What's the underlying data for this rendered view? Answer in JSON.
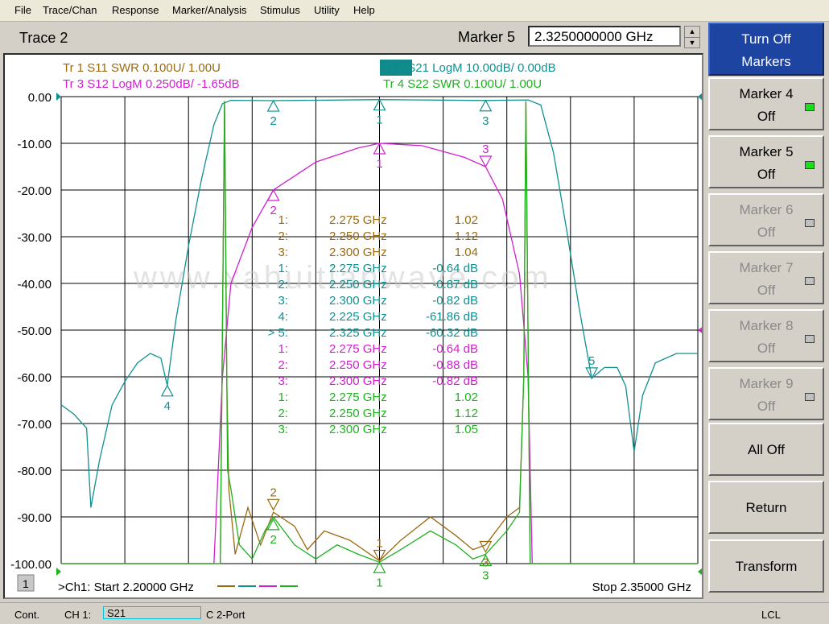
{
  "menu": [
    "File",
    "Trace/Chan",
    "Response",
    "Marker/Analysis",
    "Stimulus",
    "Utility",
    "Help"
  ],
  "header": {
    "trace_title": "Trace 2",
    "marker_label": "Marker 5",
    "marker_value": "2.3250000000 GHz"
  },
  "trace_labels": [
    {
      "text": "Tr  1  S11 SWR 0.100U/  1.00U",
      "color": "#9a6a10"
    },
    {
      "text": "Tr  2  S21 LogM 10.00dB/  0.00dB",
      "color": "#109090"
    },
    {
      "text": "Tr  3  S12 LogM 0.250dB/  -1.65dB",
      "color": "#d020d0"
    },
    {
      "text": "Tr  4  S22 SWR 0.100U/  1.00U",
      "color": "#20b020"
    }
  ],
  "marker_table": [
    {
      "n": "1:",
      "f": "2.275 GHz",
      "v": "1.02",
      "color": "#9a6a10"
    },
    {
      "n": "2:",
      "f": "2.250 GHz",
      "v": "1.12",
      "color": "#9a6a10"
    },
    {
      "n": "3:",
      "f": "2.300 GHz",
      "v": "1.04",
      "color": "#9a6a10"
    },
    {
      "n": "1:",
      "f": "2.275 GHz",
      "v": "-0.64 dB",
      "color": "#109090"
    },
    {
      "n": "2:",
      "f": "2.250 GHz",
      "v": "-0.87 dB",
      "color": "#109090"
    },
    {
      "n": "3:",
      "f": "2.300 GHz",
      "v": "-0.82 dB",
      "color": "#109090"
    },
    {
      "n": "4:",
      "f": "2.225 GHz",
      "v": "-61.86 dB",
      "color": "#109090"
    },
    {
      "n": "> 5:",
      "f": "2.325 GHz",
      "v": "-60.32 dB",
      "color": "#109090"
    },
    {
      "n": "1:",
      "f": "2.275 GHz",
      "v": "-0.64 dB",
      "color": "#d020d0"
    },
    {
      "n": "2:",
      "f": "2.250 GHz",
      "v": "-0.88 dB",
      "color": "#d020d0"
    },
    {
      "n": "3:",
      "f": "2.300 GHz",
      "v": "-0.82 dB",
      "color": "#d020d0"
    },
    {
      "n": "1:",
      "f": "2.275 GHz",
      "v": "1.02",
      "color": "#20b020"
    },
    {
      "n": "2:",
      "f": "2.250 GHz",
      "v": "1.12",
      "color": "#20b020"
    },
    {
      "n": "3:",
      "f": "2.300 GHz",
      "v": "1.05",
      "color": "#20b020"
    }
  ],
  "watermark": "www.xahuitianwave.com",
  "footer": {
    "channel": "1",
    "start": ">Ch1: Start  2.20000 GHz",
    "stop": "Stop  2.35000 GHz"
  },
  "softkeys": [
    {
      "l1": "Turn Off",
      "l2": "Markers",
      "state": "primary",
      "led": "none"
    },
    {
      "l1": "Marker 4",
      "l2": "Off",
      "state": "enabled",
      "led": "on"
    },
    {
      "l1": "Marker 5",
      "l2": "Off",
      "state": "enabled",
      "led": "on"
    },
    {
      "l1": "Marker 6",
      "l2": "Off",
      "state": "disabled",
      "led": "off"
    },
    {
      "l1": "Marker 7",
      "l2": "Off",
      "state": "disabled",
      "led": "off"
    },
    {
      "l1": "Marker 8",
      "l2": "Off",
      "state": "disabled",
      "led": "off"
    },
    {
      "l1": "Marker 9",
      "l2": "Off",
      "state": "disabled",
      "led": "off"
    },
    {
      "l1": "All Off",
      "l2": "",
      "state": "enabled",
      "led": "none"
    },
    {
      "l1": "Return",
      "l2": "",
      "state": "enabled",
      "led": "none"
    },
    {
      "l1": "Transform",
      "l2": "",
      "state": "enabled",
      "led": "none"
    }
  ],
  "status": {
    "mode": "Cont.",
    "channel": "CH 1:",
    "param": "S21",
    "port": "C  2-Port",
    "lcl": "LCL"
  },
  "chart_data": {
    "type": "line",
    "title": "",
    "xlabel": "",
    "ylabel": "",
    "xlim": [
      2.2,
      2.35
    ],
    "ylim": [
      -100,
      0
    ],
    "yticks": [
      "0.00",
      "-10.00",
      "-20.00",
      "-30.00",
      "-40.00",
      "-50.00",
      "-60.00",
      "-70.00",
      "-80.00",
      "-90.00",
      "-100.00"
    ],
    "grid": true,
    "colors": {
      "S11": "#9a6a10",
      "S21": "#109090",
      "S12": "#d020d0",
      "S22": "#20b020"
    },
    "series": [
      {
        "name": "S21",
        "points": [
          [
            2.2,
            -66
          ],
          [
            2.203,
            -68
          ],
          [
            2.206,
            -71
          ],
          [
            2.207,
            -88
          ],
          [
            2.209,
            -78
          ],
          [
            2.212,
            -66
          ],
          [
            2.215,
            -61
          ],
          [
            2.218,
            -57
          ],
          [
            2.221,
            -55
          ],
          [
            2.2235,
            -56
          ],
          [
            2.225,
            -61.86
          ],
          [
            2.227,
            -48
          ],
          [
            2.23,
            -32
          ],
          [
            2.233,
            -18
          ],
          [
            2.236,
            -6
          ],
          [
            2.238,
            -1.5
          ],
          [
            2.24,
            -0.8
          ],
          [
            2.25,
            -0.87
          ],
          [
            2.275,
            -0.64
          ],
          [
            2.3,
            -0.82
          ],
          [
            2.31,
            -0.7
          ],
          [
            2.313,
            -1.8
          ],
          [
            2.316,
            -12
          ],
          [
            2.319,
            -28
          ],
          [
            2.322,
            -45
          ],
          [
            2.325,
            -60.32
          ],
          [
            2.328,
            -58
          ],
          [
            2.331,
            -58
          ],
          [
            2.333,
            -62
          ],
          [
            2.335,
            -76
          ],
          [
            2.337,
            -64
          ],
          [
            2.34,
            -57
          ],
          [
            2.345,
            -55
          ],
          [
            2.35,
            -55
          ]
        ]
      },
      {
        "name": "S12",
        "points": [
          [
            2.2,
            -100
          ],
          [
            2.236,
            -100
          ],
          [
            2.238,
            -60
          ],
          [
            2.24,
            -40
          ],
          [
            2.245,
            -28
          ],
          [
            2.25,
            -20
          ],
          [
            2.26,
            -14
          ],
          [
            2.27,
            -11
          ],
          [
            2.275,
            -10
          ],
          [
            2.285,
            -10.5
          ],
          [
            2.295,
            -13
          ],
          [
            2.3,
            -15
          ],
          [
            2.304,
            -22
          ],
          [
            2.308,
            -38
          ],
          [
            2.31,
            -60
          ],
          [
            2.311,
            -100
          ],
          [
            2.35,
            -100
          ]
        ]
      },
      {
        "name": "S11",
        "points": [
          [
            2.2,
            -100
          ],
          [
            2.2375,
            -100
          ],
          [
            2.2385,
            -1
          ],
          [
            2.239,
            -60
          ],
          [
            2.2395,
            -84
          ],
          [
            2.241,
            -98
          ],
          [
            2.244,
            -88
          ],
          [
            2.247,
            -96
          ],
          [
            2.25,
            -89
          ],
          [
            2.255,
            -92
          ],
          [
            2.258,
            -97
          ],
          [
            2.262,
            -93
          ],
          [
            2.268,
            -95
          ],
          [
            2.275,
            -99.4
          ],
          [
            2.28,
            -95
          ],
          [
            2.287,
            -90
          ],
          [
            2.293,
            -94
          ],
          [
            2.297,
            -97
          ],
          [
            2.3,
            -96
          ],
          [
            2.305,
            -90
          ],
          [
            2.308,
            -88
          ],
          [
            2.309,
            -60
          ],
          [
            2.3095,
            -1
          ],
          [
            2.3105,
            -100
          ],
          [
            2.35,
            -100
          ]
        ]
      },
      {
        "name": "S22",
        "points": [
          [
            2.2,
            -100
          ],
          [
            2.2375,
            -100
          ],
          [
            2.2385,
            -1
          ],
          [
            2.2392,
            -80
          ],
          [
            2.24,
            -84
          ],
          [
            2.242,
            -96
          ],
          [
            2.245,
            -99
          ],
          [
            2.248,
            -93
          ],
          [
            2.25,
            -90
          ],
          [
            2.255,
            -96
          ],
          [
            2.26,
            -99
          ],
          [
            2.265,
            -96
          ],
          [
            2.27,
            -98
          ],
          [
            2.275,
            -99.7
          ],
          [
            2.28,
            -97
          ],
          [
            2.287,
            -93
          ],
          [
            2.293,
            -96
          ],
          [
            2.297,
            -99
          ],
          [
            2.3,
            -98
          ],
          [
            2.305,
            -93
          ],
          [
            2.308,
            -89
          ],
          [
            2.309,
            -60
          ],
          [
            2.3095,
            -1
          ],
          [
            2.3105,
            -100
          ],
          [
            2.35,
            -100
          ]
        ]
      }
    ],
    "markers": [
      {
        "series": "S21",
        "x": 2.275,
        "y": -0.64,
        "label": "1",
        "dir": "up",
        "lpos": "below"
      },
      {
        "series": "S21",
        "x": 2.25,
        "y": -0.87,
        "label": "2",
        "dir": "up",
        "lpos": "below"
      },
      {
        "series": "S21",
        "x": 2.3,
        "y": -0.82,
        "label": "3",
        "dir": "up",
        "lpos": "below"
      },
      {
        "series": "S21",
        "x": 2.225,
        "y": -61.86,
        "label": "4",
        "dir": "up",
        "lpos": "below"
      },
      {
        "series": "S21",
        "x": 2.325,
        "y": -60.32,
        "label": "5",
        "dir": "down",
        "lpos": "above"
      },
      {
        "series": "S12",
        "x": 2.275,
        "y": -10,
        "label": "1",
        "dir": "up",
        "lpos": "below"
      },
      {
        "series": "S12",
        "x": 2.25,
        "y": -20,
        "label": "2",
        "dir": "up",
        "lpos": "below"
      },
      {
        "series": "S12",
        "x": 2.3,
        "y": -15,
        "label": "3",
        "dir": "down",
        "lpos": "above"
      },
      {
        "series": "S11",
        "x": 2.275,
        "y": -99.4,
        "label": "1",
        "dir": "down",
        "lpos": "above"
      },
      {
        "series": "S11",
        "x": 2.25,
        "y": -88.5,
        "label": "2",
        "dir": "down",
        "lpos": "above"
      },
      {
        "series": "S11",
        "x": 2.3,
        "y": -97.5,
        "label": "3",
        "dir": "down",
        "lpos": "below"
      },
      {
        "series": "S22",
        "x": 2.275,
        "y": -99.7,
        "label": "1",
        "dir": "up",
        "lpos": "below"
      },
      {
        "series": "S22",
        "x": 2.25,
        "y": -90.5,
        "label": "2",
        "dir": "up",
        "lpos": "below"
      },
      {
        "series": "S22",
        "x": 2.3,
        "y": -98.2,
        "label": "3",
        "dir": "up",
        "lpos": "below"
      }
    ]
  }
}
